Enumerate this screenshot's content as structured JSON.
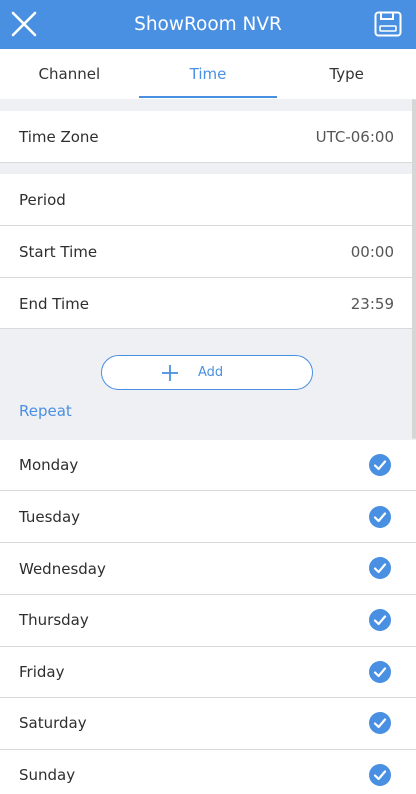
{
  "header": {
    "title": "ShowRoom NVR",
    "close_icon": "close-icon",
    "save_icon": "save-icon",
    "color": "#4a90e2"
  },
  "tabs": [
    {
      "label": "Channel",
      "active": false
    },
    {
      "label": "Time",
      "active": true
    },
    {
      "label": "Type",
      "active": false
    }
  ],
  "time_zone": {
    "label": "Time Zone",
    "value": "UTC-06:00"
  },
  "period": {
    "label": "Period",
    "start": {
      "label": "Start Time",
      "value": "00:00"
    },
    "end": {
      "label": "End Time",
      "value": "23:59"
    }
  },
  "add_button": {
    "label": "Add",
    "icon": "plus-icon"
  },
  "repeat": {
    "label": "Repeat",
    "days": [
      {
        "label": "Monday",
        "checked": true
      },
      {
        "label": "Tuesday",
        "checked": true
      },
      {
        "label": "Wednesday",
        "checked": true
      },
      {
        "label": "Thursday",
        "checked": true
      },
      {
        "label": "Friday",
        "checked": true
      },
      {
        "label": "Saturday",
        "checked": true
      },
      {
        "label": "Sunday",
        "checked": true
      }
    ]
  }
}
